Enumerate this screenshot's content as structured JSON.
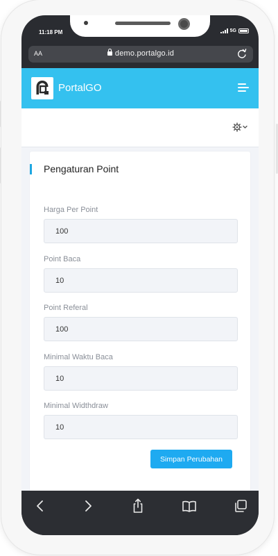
{
  "status_bar": {
    "time": "11:18 PM",
    "network": "5G"
  },
  "browser": {
    "text_size_label": "AA",
    "url": "demo.portalgo.id"
  },
  "app": {
    "brand": "PortalGO",
    "accent_color": "#34c1ef"
  },
  "settings_form": {
    "title": "Pengaturan Point",
    "fields": [
      {
        "label": "Harga Per Point",
        "value": "100"
      },
      {
        "label": "Point Baca",
        "value": "10"
      },
      {
        "label": "Point Referal",
        "value": "100"
      },
      {
        "label": "Minimal Waktu Baca",
        "value": "10"
      },
      {
        "label": "Minimal Widthdraw",
        "value": "10"
      }
    ],
    "save_label": "Simpan Perubahan"
  },
  "toolbar": {
    "icons": [
      "back-arrow-icon",
      "forward-arrow-icon",
      "share-icon",
      "bookmarks-icon",
      "tabs-icon"
    ]
  }
}
